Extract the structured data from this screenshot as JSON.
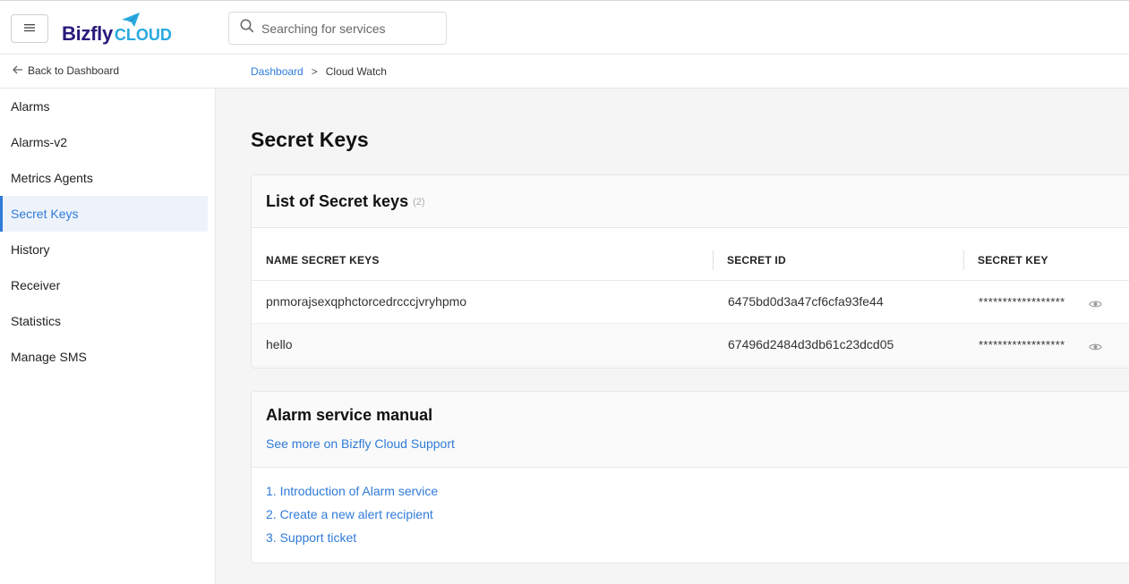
{
  "header": {
    "brand_main": "Bizfly",
    "brand_sub": "CLOUD",
    "search_placeholder": "Searching for services"
  },
  "subheader": {
    "back_label": "Back to Dashboard",
    "breadcrumb": {
      "link": "Dashboard",
      "separator": ">",
      "current": "Cloud Watch"
    }
  },
  "sidebar": {
    "items": [
      {
        "label": "Alarms"
      },
      {
        "label": "Alarms-v2"
      },
      {
        "label": "Metrics Agents"
      },
      {
        "label": "Secret Keys",
        "active": true
      },
      {
        "label": "History"
      },
      {
        "label": "Receiver"
      },
      {
        "label": "Statistics"
      },
      {
        "label": "Manage SMS"
      }
    ]
  },
  "main": {
    "page_title": "Secret Keys",
    "secret_keys_card": {
      "title": "List of Secret keys",
      "count": "(2)",
      "columns": [
        "NAME SECRET KEYS",
        "SECRET ID",
        "SECRET KEY"
      ],
      "rows": [
        {
          "name": "pnmorajsexqphctorcedrcccjvryhpmo",
          "id": "6475bd0d3a47cf6cfa93fe44",
          "key": "******************"
        },
        {
          "name": "hello",
          "id": "67496d2484d3db61c23dcd05",
          "key": "******************"
        }
      ]
    },
    "manual_card": {
      "title": "Alarm service manual",
      "support_link": "See more on Bizfly Cloud Support",
      "items": [
        "1. Introduction of Alarm service",
        "2. Create a new alert recipient",
        "3. Support ticket"
      ]
    }
  },
  "colors": {
    "accent": "#2f7bd9",
    "brand_dark": "#2b1a7a",
    "brand_light": "#28a9e0"
  },
  "icons": [
    "menu-icon",
    "paper-plane-icon",
    "search-icon",
    "arrow-left-icon",
    "eye-icon"
  ]
}
